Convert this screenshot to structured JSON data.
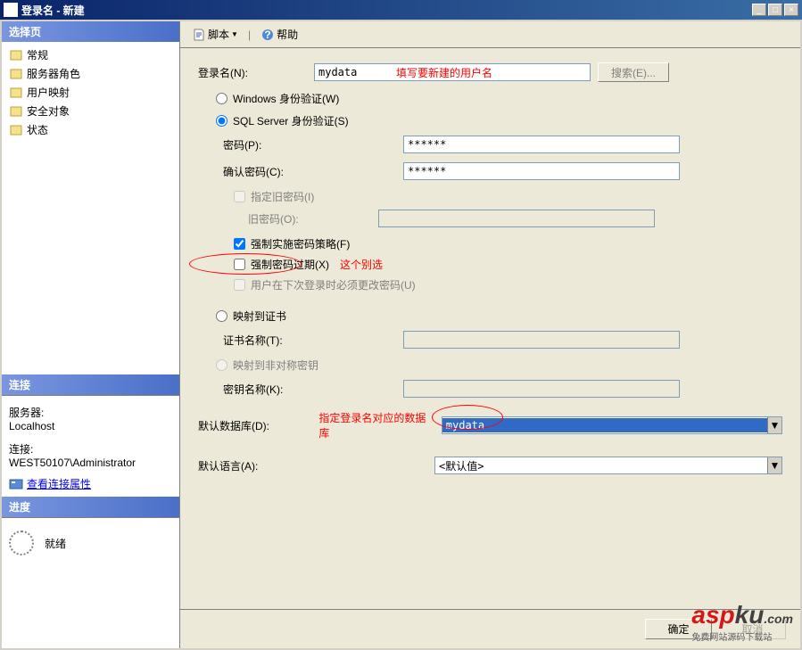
{
  "title": "登录名 - 新建",
  "sidebar": {
    "header": "选择页",
    "items": [
      {
        "label": "常规"
      },
      {
        "label": "服务器角色"
      },
      {
        "label": "用户映射"
      },
      {
        "label": "安全对象"
      },
      {
        "label": "状态"
      }
    ]
  },
  "connection": {
    "header": "连接",
    "server_label": "服务器:",
    "server_value": "Localhost",
    "conn_label": "连接:",
    "conn_value": "WEST50107\\Administrator",
    "view_props": "查看连接属性"
  },
  "progress": {
    "header": "进度",
    "status": "就绪"
  },
  "toolbar": {
    "script": "脚本",
    "help": "帮助"
  },
  "form": {
    "login_name_label": "登录名(N):",
    "login_name_value": "mydata",
    "login_annotation": "填写要新建的用户名",
    "search_btn": "搜索(E)...",
    "windows_auth": "Windows 身份验证(W)",
    "sql_auth": "SQL Server 身份验证(S)",
    "password_label": "密码(P):",
    "password_value": "******",
    "confirm_password_label": "确认密码(C):",
    "confirm_password_value": "******",
    "specify_old_pw": "指定旧密码(I)",
    "old_pw_label": "旧密码(O):",
    "enforce_policy": "强制实施密码策略(F)",
    "enforce_expiry": "强制密码过期(X)",
    "expiry_annotation": "这个别选",
    "must_change": "用户在下次登录时必须更改密码(U)",
    "map_cert": "映射到证书",
    "cert_name_label": "证书名称(T):",
    "map_asym": "映射到非对称密钥",
    "key_name_label": "密钥名称(K):",
    "default_db_label": "默认数据库(D):",
    "default_db_value": "mydata",
    "db_annotation": "指定登录名对应的数据库",
    "default_lang_label": "默认语言(A):",
    "default_lang_value": "<默认值>"
  },
  "buttons": {
    "ok": "确定",
    "cancel": "取消"
  },
  "watermark": {
    "brand1": "asp",
    "brand2": "ku",
    "domain": ".com",
    "sub": "免费网站源码下载站"
  }
}
